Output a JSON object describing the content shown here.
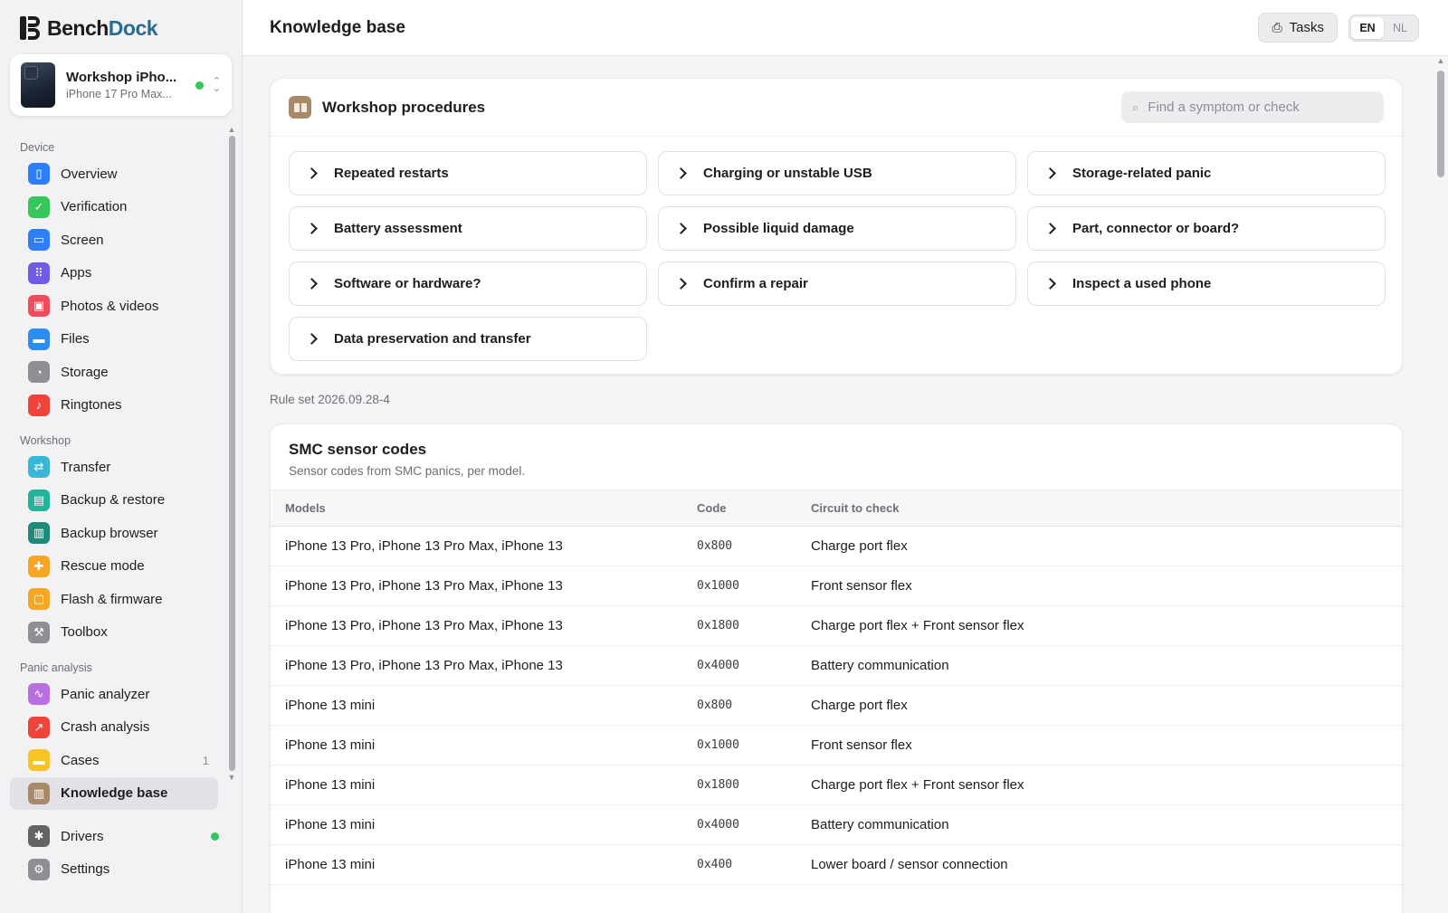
{
  "brand": {
    "part1": "Bench",
    "part2": "Dock"
  },
  "device": {
    "name": "Workshop iPho...",
    "model": "iPhone 17 Pro Max..."
  },
  "sidebar": {
    "sections": [
      {
        "label": "Device",
        "items": [
          {
            "label": "Overview",
            "color": "#2d7ff9",
            "icon": "phone-icon",
            "glyph": "▯"
          },
          {
            "label": "Verification",
            "color": "#34c759",
            "icon": "shield-icon",
            "glyph": "✓"
          },
          {
            "label": "Screen",
            "color": "#2d7ff9",
            "icon": "screen-icon",
            "glyph": "▭"
          },
          {
            "label": "Apps",
            "color": "#6e5ce6",
            "icon": "apps-grid-icon",
            "glyph": "⠿"
          },
          {
            "label": "Photos & videos",
            "color": "#f04b5b",
            "icon": "photo-icon",
            "glyph": "▣"
          },
          {
            "label": "Files",
            "color": "#2d8cf0",
            "icon": "folder-icon",
            "glyph": "▬"
          },
          {
            "label": "Storage",
            "color": "#8e8e93",
            "icon": "pie-icon",
            "glyph": "◔"
          },
          {
            "label": "Ringtones",
            "color": "#f0443a",
            "icon": "music-note-icon",
            "glyph": "♪"
          }
        ]
      },
      {
        "label": "Workshop",
        "items": [
          {
            "label": "Transfer",
            "color": "#3ab7d6",
            "icon": "transfer-icon",
            "glyph": "⇄"
          },
          {
            "label": "Backup & restore",
            "color": "#22b39b",
            "icon": "archive-icon",
            "glyph": "▤"
          },
          {
            "label": "Backup browser",
            "color": "#1d8a7a",
            "icon": "drive-icon",
            "glyph": "▥"
          },
          {
            "label": "Rescue mode",
            "color": "#f5a623",
            "icon": "lifebuoy-icon",
            "glyph": "✚"
          },
          {
            "label": "Flash & firmware",
            "color": "#f5a623",
            "icon": "chip-icon",
            "glyph": "▢"
          },
          {
            "label": "Toolbox",
            "color": "#8e8e93",
            "icon": "wrench-icon",
            "glyph": "⚒"
          }
        ]
      },
      {
        "label": "Panic analysis",
        "items": [
          {
            "label": "Panic analyzer",
            "color": "#b86fe0",
            "icon": "pulse-icon",
            "glyph": "∿"
          },
          {
            "label": "Crash analysis",
            "color": "#f0443a",
            "icon": "trend-icon",
            "glyph": "↗"
          },
          {
            "label": "Cases",
            "color": "#f7c325",
            "icon": "folder-icon",
            "glyph": "▬",
            "count": "1"
          },
          {
            "label": "Knowledge base",
            "color": "#a88a68",
            "icon": "book-icon",
            "glyph": "▥",
            "active": true
          }
        ]
      }
    ],
    "bottom": [
      {
        "label": "Drivers",
        "color": "#636366",
        "icon": "puzzle-icon",
        "glyph": "✱",
        "status": true
      },
      {
        "label": "Settings",
        "color": "#8e8e93",
        "icon": "gear-icon",
        "glyph": "⚙"
      }
    ]
  },
  "header": {
    "title": "Knowledge base",
    "tasks_label": "Tasks",
    "lang_en": "EN",
    "lang_nl": "NL"
  },
  "procedures": {
    "title": "Workshop procedures",
    "search_placeholder": "Find a symptom or check",
    "items": [
      "Repeated restarts",
      "Charging or unstable USB",
      "Storage-related panic",
      "Battery assessment",
      "Possible liquid damage",
      "Part, connector or board?",
      "Software or hardware?",
      "Confirm a repair",
      "Inspect a used phone",
      "Data preservation and transfer"
    ]
  },
  "ruleset": "Rule set 2026.09.28-4",
  "smc": {
    "title": "SMC sensor codes",
    "subtitle": "Sensor codes from SMC panics, per model.",
    "columns": [
      "Models",
      "Code",
      "Circuit to check"
    ],
    "rows": [
      [
        "iPhone 13 Pro, iPhone 13 Pro Max, iPhone 13",
        "0x800",
        "Charge port flex"
      ],
      [
        "iPhone 13 Pro, iPhone 13 Pro Max, iPhone 13",
        "0x1000",
        "Front sensor flex"
      ],
      [
        "iPhone 13 Pro, iPhone 13 Pro Max, iPhone 13",
        "0x1800",
        "Charge port flex + Front sensor flex"
      ],
      [
        "iPhone 13 Pro, iPhone 13 Pro Max, iPhone 13",
        "0x4000",
        "Battery communication"
      ],
      [
        "iPhone 13 mini",
        "0x800",
        "Charge port flex"
      ],
      [
        "iPhone 13 mini",
        "0x1000",
        "Front sensor flex"
      ],
      [
        "iPhone 13 mini",
        "0x1800",
        "Charge port flex + Front sensor flex"
      ],
      [
        "iPhone 13 mini",
        "0x4000",
        "Battery communication"
      ],
      [
        "iPhone 13 mini",
        "0x400",
        "Lower board / sensor connection"
      ]
    ]
  }
}
